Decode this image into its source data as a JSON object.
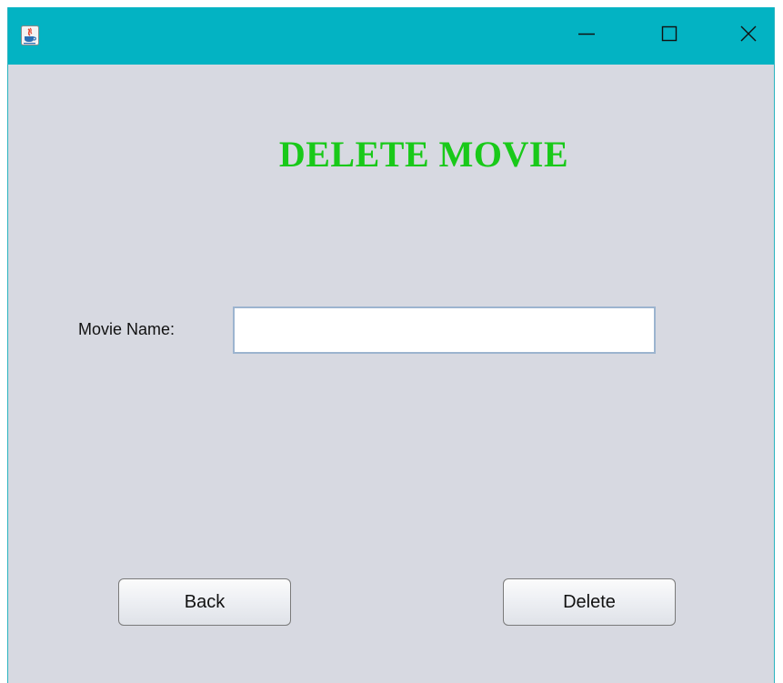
{
  "window": {
    "controls": {
      "minimize": "minimize",
      "maximize": "maximize",
      "close": "close"
    }
  },
  "form": {
    "heading": "DELETE MOVIE",
    "movie_name_label": "Movie Name:",
    "movie_name_value": "",
    "movie_name_placeholder": ""
  },
  "buttons": {
    "back_label": "Back",
    "delete_label": "Delete"
  },
  "colors": {
    "titlebar": "#03b3c3",
    "background": "#d7d9e1",
    "heading": "#19c919"
  },
  "icons": {
    "app": "java-cup-icon",
    "minimize": "minimize-icon",
    "maximize": "maximize-icon",
    "close": "close-icon"
  }
}
